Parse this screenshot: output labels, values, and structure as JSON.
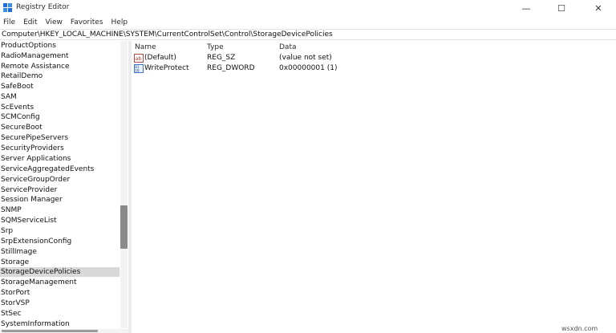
{
  "window": {
    "title": "Registry Editor",
    "controls": {
      "minimize": "—",
      "maximize": "☐",
      "close": "✕"
    }
  },
  "menu": [
    "File",
    "Edit",
    "View",
    "Favorites",
    "Help"
  ],
  "address": "Computer\\HKEY_LOCAL_MACHINE\\SYSTEM\\CurrentControlSet\\Control\\StorageDevicePolicies",
  "tree": {
    "items": [
      "ProductOptions",
      "RadioManagement",
      "Remote Assistance",
      "RetailDemo",
      "SafeBoot",
      "SAM",
      "ScEvents",
      "SCMConfig",
      "SecureBoot",
      "SecurePipeServers",
      "SecurityProviders",
      "Server Applications",
      "ServiceAggregatedEvents",
      "ServiceGroupOrder",
      "ServiceProvider",
      "Session Manager",
      "SNMP",
      "SQMServiceList",
      "Srp",
      "SrpExtensionConfig",
      "StillImage",
      "Storage",
      "StorageDevicePolicies",
      "StorageManagement",
      "StorPort",
      "StorVSP",
      "StSec",
      "SystemInformation"
    ],
    "selected": "StorageDevicePolicies"
  },
  "values": {
    "columns": {
      "name": "Name",
      "type": "Type",
      "data": "Data"
    },
    "rows": [
      {
        "name": "(Default)",
        "type": "REG_SZ",
        "data": "(value not set)",
        "icon": "string-value-icon"
      },
      {
        "name": "WriteProtect",
        "type": "REG_DWORD",
        "data": "0x00000001 (1)",
        "icon": "binary-value-icon"
      }
    ]
  },
  "watermark": "wsxdn.com",
  "colors": {
    "selection": "#d9d9d9",
    "accent": "#0a64c8",
    "string_icon": "#c0392b"
  }
}
